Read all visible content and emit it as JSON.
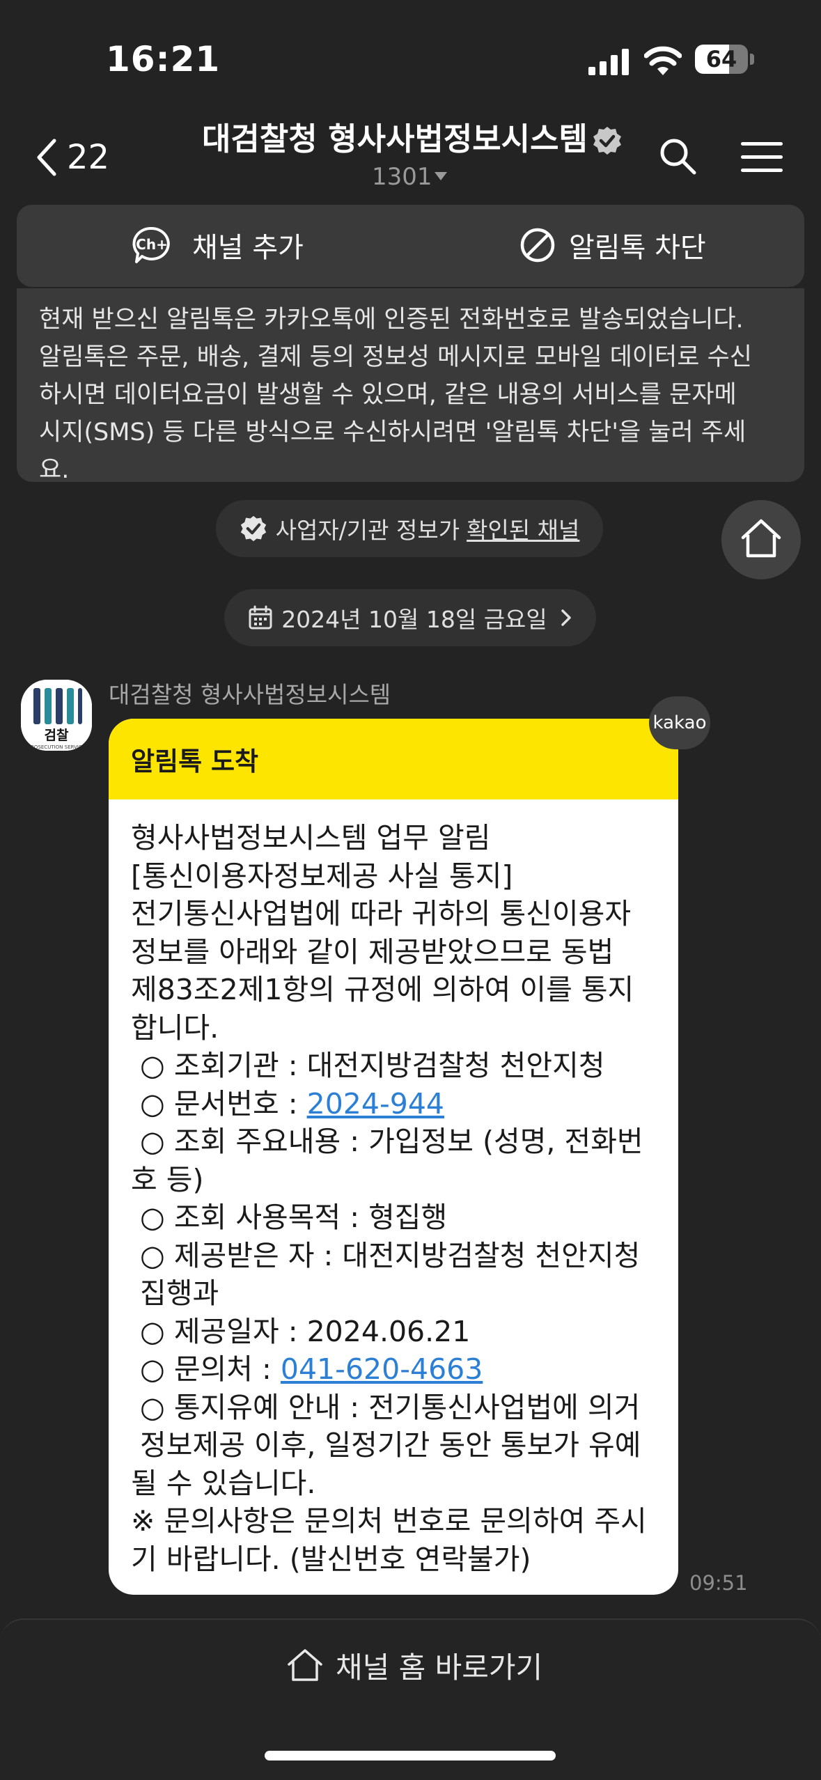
{
  "status_bar": {
    "time": "16:21",
    "battery": "64",
    "battery_level": 0.64
  },
  "nav": {
    "back_count": "22",
    "title": "대검찰청 형사사법정보시스템",
    "subtitle": "1301"
  },
  "actions": {
    "add_channel": "채널 추가",
    "add_channel_icon_text": "Ch+",
    "block": "알림톡 차단"
  },
  "notice": {
    "lines": [
      "현재 받으신 알림톡은 카카오톡에 인증된 전화번호로 발송되었습니다.",
      "알림톡은 주문, 배송, 결제 등의 정보성 메시지로 모바일 데이터로 수신",
      "하시면 데이터요금이 발생할 수 있으며, 같은 내용의 서비스를 문자메",
      "시지(SMS) 등 다른 방식으로 수신하시려면 '알림톡 차단'을 눌러 주세",
      "요."
    ]
  },
  "verified_pill": {
    "text": "사업자/기관 정보가",
    "link": "확인된 채널"
  },
  "date_pill": "2024년 10월 18일 금요일",
  "message": {
    "sender": "대검찰청 형사사법정보시스템",
    "avatar_label": "검찰",
    "avatar_sublabel": "PROSECUTION SERVICE",
    "badge": "kakao",
    "header": "알림톡 도착",
    "lines": [
      "형사사법정보시스템 업무 알림",
      "[통신이용자정보제공 사실 통지]",
      "전기통신사업법에 따라 귀하의 통신이용자",
      "정보를 아래와 같이 제공받았으므로 동법",
      "제83조2제1항의 규정에 의하여 이를 통지",
      "합니다.",
      " ○ 조회기관 : 대전지방검찰청 천안지청"
    ],
    "doc_prefix": " ○ 문서번호 : ",
    "doc_link": "2024-944",
    "lines2": [
      " ○ 조회 주요내용 : 가입정보 (성명, 전화번",
      "호 등)",
      " ○ 조회 사용목적 : 형집행",
      " ○ 제공받은 자 : 대전지방검찰청 천안지청",
      " 집행과",
      " ○ 제공일자 : 2024.06.21"
    ],
    "contact_prefix": " ○ 문의처 : ",
    "contact_link": "041-620-4663",
    "lines3": [
      " ○ 통지유예 안내 : 전기통신사업법에 의거",
      " 정보제공 이후, 일정기간 동안 통보가 유예",
      "될 수 있습니다.",
      "※ 문의사항은 문의처 번호로 문의하여 주시",
      "기 바랍니다. (발신번호 연락불가)"
    ],
    "time": "09:51"
  },
  "bottom": {
    "home_link": "채널 홈 바로가기"
  }
}
